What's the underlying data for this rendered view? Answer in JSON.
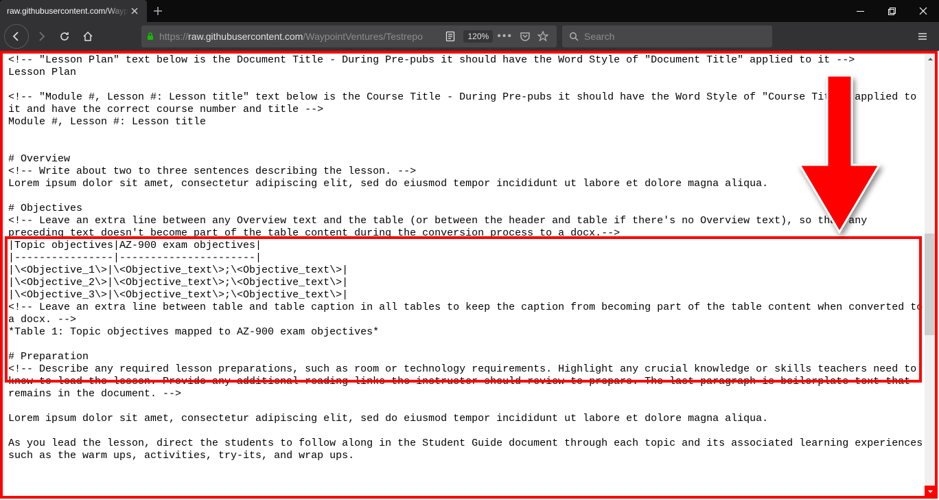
{
  "window": {
    "tab_title": "raw.githubusercontent.com/Wayp"
  },
  "toolbar": {
    "url_prefix": "https://",
    "url_domain": "raw.githubusercontent.com",
    "url_path": "/WaypointVentures/Testrepo",
    "zoom": "120%",
    "search_placeholder": "Search"
  },
  "content": {
    "line01": "<!-- \"Lesson Plan\" text below is the Document Title - During Pre-pubs it should have the Word Style of \"Document Title\" applied to it -->",
    "line02": "Lesson Plan",
    "blank1": "",
    "line03": "<!-- \"Module #, Lesson #: Lesson title\" text below is the Course Title - During Pre-pubs it should have the Word Style of \"Course Title\" applied to it and have the correct course number and title -->",
    "line04": "Module #, Lesson #: Lesson title",
    "blank2": "",
    "blank3": "",
    "line05": "# Overview",
    "line06": "<!-- Write about two to three sentences describing the lesson. -->",
    "line07": "Lorem ipsum dolor sit amet, consectetur adipiscing elit, sed do eiusmod tempor incididunt ut labore et dolore magna aliqua.",
    "blank4": "",
    "line08": "# Objectives",
    "line09": "<!-- Leave an extra line between any Overview text and the table (or between the header and table if there's no Overview text), so that any preceding text doesn't become part of the table content during the conversion process to a docx.-->",
    "line10": "|Topic objectives|AZ-900 exam objectives|",
    "line11": "|----------------|----------------------|",
    "line12": "|\\<Objective_1\\>|\\<Objective_text\\>;\\<Objective_text\\>|",
    "line13": "|\\<Objective_2\\>|\\<Objective_text\\>;\\<Objective_text\\>|",
    "line14": "|\\<Objective_3\\>|\\<Objective_text\\>;\\<Objective_text\\>|",
    "line15": "<!-- Leave an extra line between table and table caption in all tables to keep the caption from becoming part of the table content when converted to a docx. -->",
    "line16": "*Table 1: Topic objectives mapped to AZ-900 exam objectives*",
    "blank5": "",
    "line17": "# Preparation",
    "line18": "<!-- Describe any required lesson preparations, such as room or technology requirements. Highlight any crucial knowledge or skills teachers need to know to lead the lesson. Provide any additional reading links the instructor should review to prepare. The last paragraph is boilerplate text that remains in the document. -->",
    "blank6": "",
    "line19": "Lorem ipsum dolor sit amet, consectetur adipiscing elit, sed do eiusmod tempor incididunt ut labore et dolore magna aliqua.",
    "blank7": "",
    "line20": "As you lead the lesson, direct the students to follow along in the Student Guide document through each topic and its associated learning experiences such as the warm ups, activities, try-its, and wrap ups."
  }
}
